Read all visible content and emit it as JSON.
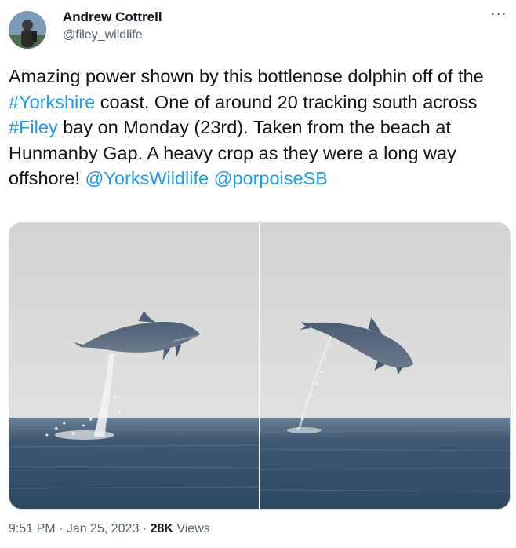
{
  "author": {
    "name": "Andrew Cottrell",
    "handle": "@filey_wildlife"
  },
  "more_icon": "more-horizontal-icon",
  "text_parts": [
    {
      "t": "Amazing power shown by this bottlenose dolphin off of the ",
      "link": false
    },
    {
      "t": "#Yorkshire",
      "link": true
    },
    {
      "t": " coast.  One of around 20 tracking south across ",
      "link": false
    },
    {
      "t": "#Filey",
      "link": true
    },
    {
      "t": " bay on Monday (23rd).  Taken from the beach at Hunmanby Gap. A heavy crop as they were a long way offshore! ",
      "link": false
    },
    {
      "t": "@YorksWildlife",
      "link": true
    },
    {
      "t": " ",
      "link": false
    },
    {
      "t": "@porpoiseSB",
      "link": true
    }
  ],
  "meta": {
    "time": "9:51 PM",
    "sep1": " · ",
    "date": "Jan 25, 2023",
    "sep2": " · ",
    "views_count": "28K",
    "views_label": " Views"
  },
  "colors": {
    "link": "#1d9bf0",
    "secondary_text": "#536471",
    "sky": "#dcdcdc",
    "sea": "#3d5670",
    "dolphin": "#5b6b80"
  }
}
